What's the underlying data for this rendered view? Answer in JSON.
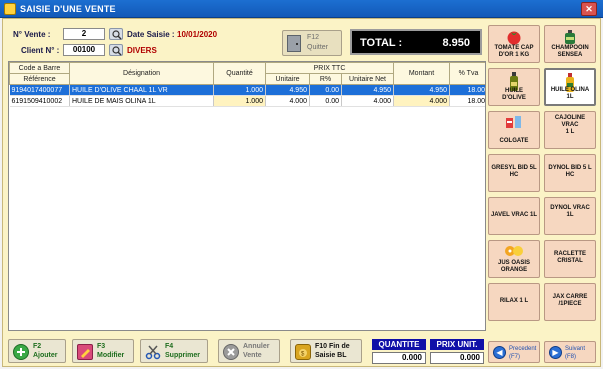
{
  "window": {
    "title": "SAISIE D'UNE VENTE",
    "close_label": "✕"
  },
  "header": {
    "vente_label": "N° Vente :",
    "vente_value": "2",
    "client_label": "Client N° :",
    "client_value": "00100",
    "client_name": "DIVERS",
    "date_label": "Date Saisie :",
    "date_value": "10/01/2020",
    "quit_fkey": "F12",
    "quit_label": "Quitter",
    "total_label": "TOTAL :",
    "total_value": "8.950"
  },
  "grid": {
    "columns": {
      "code_top": "Code a Barre",
      "code_bottom": "Référence",
      "designation": "Désignation",
      "quantite": "Quantité",
      "prix_group": "PRIX TTC",
      "unitaire": "Unitaire",
      "remise": "R%",
      "unitaire_net": "Unitaire Net",
      "montant": "Montant",
      "tva": "% Tva"
    },
    "rows": [
      {
        "code": "9194017400077",
        "designation": "HUILE D'OLIVE CHAAL 1L VR",
        "quantite": "1.000",
        "unitaire": "4.950",
        "remise": "0.00",
        "unitaire_net": "4.950",
        "montant": "4.950",
        "tva": "18.00"
      },
      {
        "code": "6191509410002",
        "designation": "HUILE DE MAIS OLINA 1L",
        "quantite": "1.000",
        "unitaire": "4.000",
        "remise": "0.00",
        "unitaire_net": "4.000",
        "montant": "4.000",
        "tva": "18.00"
      }
    ]
  },
  "bottom": {
    "ajouter": {
      "fkey": "F2",
      "label": "Ajouter"
    },
    "modifier": {
      "fkey": "F3",
      "label": "Modifier"
    },
    "supprimer": {
      "fkey": "F4",
      "label": "Supprimer"
    },
    "annuler": {
      "line1": "Annuler",
      "line2": "Vente"
    },
    "fin": {
      "fkey": "F10",
      "line1": "Fin de",
      "line2": "Saisie BL"
    },
    "quantite_label": "QUANTITE",
    "quantite_value": "0.000",
    "prix_label": "PRIX UNIT.",
    "prix_value": "0.000"
  },
  "products": [
    {
      "line1": "TOMATE CAP",
      "line2": "D'OR 1 KG",
      "icon": "tomato-icon"
    },
    {
      "line1": "CHAMPOOIN",
      "line2": "SENSEA",
      "icon": "shampoo-icon"
    },
    {
      "line1": "HUILE",
      "line2": "D'OLIVE",
      "icon": "oil-bottle-icon"
    },
    {
      "line1": "HUILE OLINA",
      "line2": "1L",
      "icon": "oil-bottle-icon"
    },
    {
      "line1": "COLGATE",
      "line2": "",
      "icon": "toothpaste-icon"
    },
    {
      "line1": "CAJOLINE VRAC",
      "line2": "1 L",
      "icon": ""
    },
    {
      "line1": "GRESYL BID 5L",
      "line2": "HC",
      "icon": ""
    },
    {
      "line1": "DYNOL BID 5 L",
      "line2": "HC",
      "icon": ""
    },
    {
      "line1": "JAVEL VRAC 1L",
      "line2": "",
      "icon": ""
    },
    {
      "line1": "DYNOL VRAC 1L",
      "line2": "",
      "icon": ""
    },
    {
      "line1": "JUS OASIS",
      "line2": "ORANGE",
      "icon": "juice-icon"
    },
    {
      "line1": "RACLETTE",
      "line2": "CRISTAL",
      "icon": ""
    },
    {
      "line1": "RILAX 1 L",
      "line2": "",
      "icon": ""
    },
    {
      "line1": "JAX CARRE",
      "line2": "/1PIECE",
      "icon": ""
    }
  ],
  "nav": {
    "prev_label": "Precedent",
    "prev_key": "(F7)",
    "next_label": "Suivant",
    "next_key": "(F8)"
  },
  "colors": {
    "selection": "#1d6fd8",
    "frame": "#fbf3c6",
    "total_bg": "#000000",
    "product_bg": "#f6d7c0"
  }
}
